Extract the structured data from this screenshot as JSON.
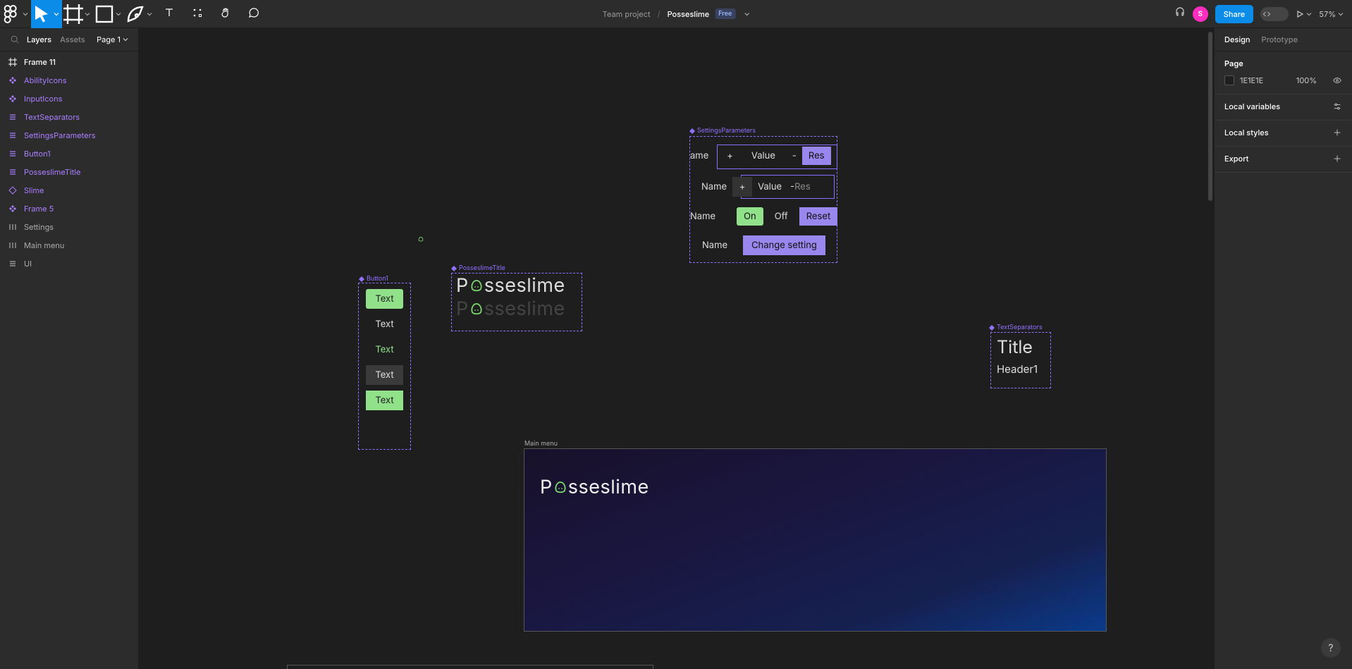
{
  "toolbar": {
    "project": "Team project",
    "file": "Posseslime",
    "plan_badge": "Free",
    "share": "Share",
    "avatar_initial": "S",
    "zoom": "57%"
  },
  "left_panel": {
    "tabs": {
      "layers": "Layers",
      "assets": "Assets"
    },
    "page_selector": "Page 1",
    "layers": [
      {
        "name": "Frame 11",
        "icon": "frame",
        "style": "white"
      },
      {
        "name": "AbilityIcons",
        "icon": "component",
        "style": "purple"
      },
      {
        "name": "InputIcons",
        "icon": "component",
        "style": "purple"
      },
      {
        "name": "TextSeparators",
        "icon": "list",
        "style": "purple"
      },
      {
        "name": "SettingsParameters",
        "icon": "list",
        "style": "purple"
      },
      {
        "name": "Button1",
        "icon": "list",
        "style": "purple"
      },
      {
        "name": "PosseslimeTitle",
        "icon": "list",
        "style": "purple"
      },
      {
        "name": "Slime",
        "icon": "diamond",
        "style": "purple"
      },
      {
        "name": "Frame 5",
        "icon": "component",
        "style": "purple"
      },
      {
        "name": "Settings",
        "icon": "hframe",
        "style": "gray"
      },
      {
        "name": "Main menu",
        "icon": "hframe",
        "style": "gray"
      },
      {
        "name": "UI",
        "icon": "list",
        "style": "gray"
      }
    ]
  },
  "right_panel": {
    "tabs": {
      "design": "Design",
      "prototype": "Prototype"
    },
    "page_section": {
      "title": "Page",
      "color_hex": "1E1E1E",
      "opacity": "100%"
    },
    "local_variables": "Local variables",
    "local_styles": "Local styles",
    "export": "Export"
  },
  "canvas": {
    "settings_parameters": {
      "label": "SettingsParameters",
      "row1": {
        "name": "ame",
        "plus": "+",
        "value": "Value",
        "minus": "-",
        "reset": "Res"
      },
      "row2": {
        "name": "Name",
        "plus": "+",
        "value": "Value",
        "minus_reset": "-Res"
      },
      "row3": {
        "name": "Name",
        "on": "On",
        "off": "Off",
        "reset": "Reset"
      },
      "row4": {
        "name": "Name",
        "change": "Change setting"
      }
    },
    "button1": {
      "label": "Button1",
      "items": [
        "Text",
        "Text",
        "Text",
        "Text",
        "Text"
      ]
    },
    "posseslime_title": {
      "label": "PosseslimeTitle",
      "text_before": "P",
      "text_after": "sseslime"
    },
    "text_separators": {
      "label": "TextSeparators",
      "title": "Title",
      "header": "Header1"
    },
    "main_menu": {
      "label": "Main menu",
      "title_before": "P",
      "title_after": "sseslime"
    }
  },
  "help": "?"
}
